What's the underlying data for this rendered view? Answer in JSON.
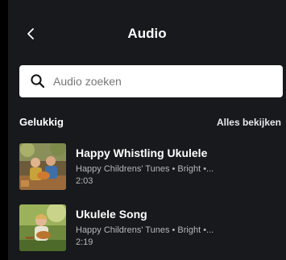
{
  "header": {
    "title": "Audio"
  },
  "search": {
    "placeholder": "Audio zoeken",
    "value": ""
  },
  "section": {
    "title": "Gelukkig",
    "see_all_label": "Alles bekijken"
  },
  "tracks": [
    {
      "title": "Happy Whistling Ukulele",
      "meta": "Happy Childrens' Tunes • Bright •...",
      "duration": "2:03"
    },
    {
      "title": "Ukulele Song",
      "meta": "Happy Childrens' Tunes • Bright •...",
      "duration": "2:19"
    }
  ],
  "colors": {
    "panel_bg": "#17191c",
    "outer_bg": "#000000",
    "search_bg": "#ffffff",
    "secondary_text": "#b6b7b9"
  },
  "icons": {
    "back": "chevron-left-icon",
    "search": "search-icon"
  }
}
